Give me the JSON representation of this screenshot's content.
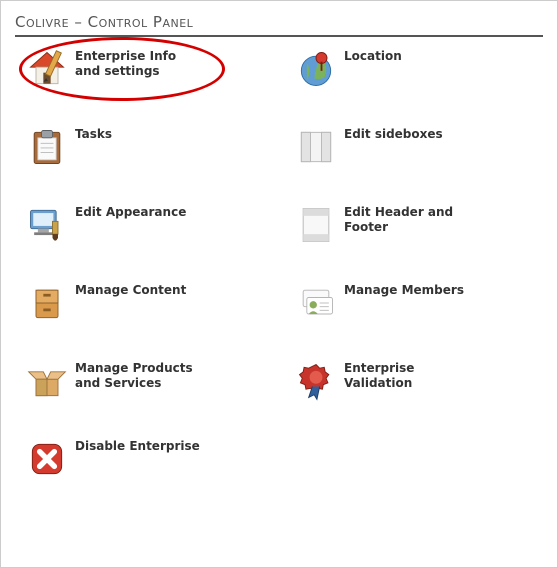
{
  "title": "Colivre – Control Panel",
  "items": [
    {
      "key": "info",
      "label": "Enterprise Info and settings",
      "highlighted": true
    },
    {
      "key": "location",
      "label": "Location"
    },
    {
      "key": "tasks",
      "label": "Tasks"
    },
    {
      "key": "sideboxes",
      "label": "Edit sideboxes"
    },
    {
      "key": "appearance",
      "label": "Edit Appearance"
    },
    {
      "key": "headerfooter",
      "label": "Edit Header and Footer"
    },
    {
      "key": "content",
      "label": "Manage Content"
    },
    {
      "key": "members",
      "label": "Manage Members"
    },
    {
      "key": "products",
      "label": "Manage Products and Services"
    },
    {
      "key": "validation",
      "label": "Enterprise Validation"
    },
    {
      "key": "disable",
      "label": "Disable Enterprise"
    }
  ]
}
